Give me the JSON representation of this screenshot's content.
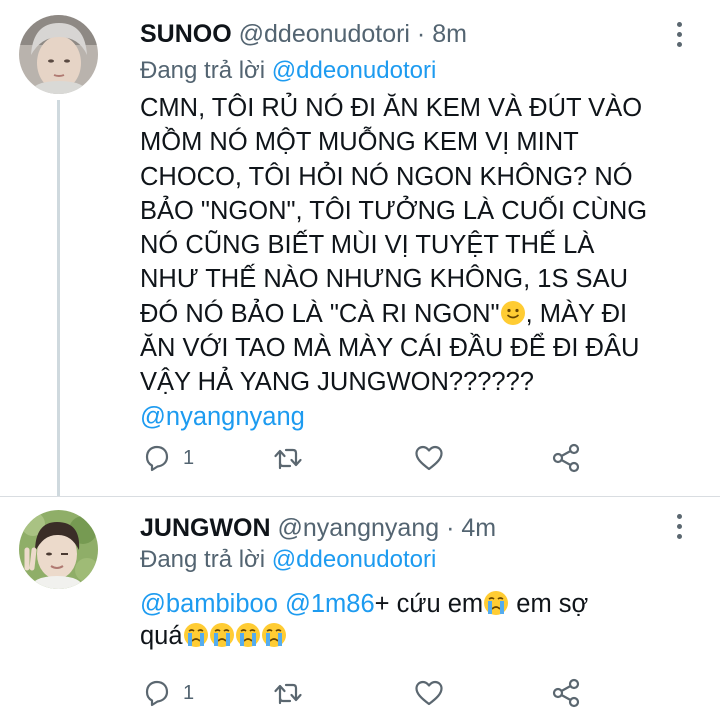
{
  "tweets": [
    {
      "name": "SUNOO",
      "handle": "@ddeonudotori",
      "time": "8m",
      "replying_prefix": "Đang trả lời",
      "replying_to": "@ddeonudotori",
      "body_lines": [
        "CMN, TÔI RỦ NÓ ĐI ĂN KEM VÀ ĐÚT VÀO",
        "MỒM NÓ MỘT MUỖNG KEM VỊ MINT",
        "CHOCO, TÔI HỎI NÓ NGON KHÔNG? NÓ",
        "BẢO \"NGON\", TÔI TƯỞNG LÀ CUỐI CÙNG",
        "NÓ CŨNG BIẾT MÙI VỊ TUYỆT THẾ LÀ",
        "NHƯ THẾ NÀO NHƯNG KHÔNG, 1S SAU",
        "ĐÓ NÓ BẢO LÀ \"CÀ RI NGON\"",
        ", MÀY ĐI",
        "ĂN VỚI TAO MÀ MÀY CÁI ĐẦU ĐỂ ĐI ĐÂU",
        "VẬY HẢ YANG JUNGWON??????",
        "@nyangnyang"
      ],
      "reply_count": "1",
      "icons": [
        "reply-icon",
        "retweet-icon",
        "like-icon",
        "share-icon",
        "smile-emoji"
      ]
    },
    {
      "name": "JUNGWON",
      "handle": "@nyangnyang",
      "time": "4m",
      "replying_prefix": "Đang trả lời",
      "replying_to": "@ddeonudotori",
      "mentions": [
        "@bambiboo",
        "@1m86"
      ],
      "text_a": "+ cứu em",
      "text_b": " em sợ",
      "text_c": "quá",
      "reply_count": "1",
      "icons": [
        "reply-icon",
        "retweet-icon",
        "like-icon",
        "share-icon",
        "crying-emoji"
      ]
    }
  ],
  "separator": " · ",
  "colors": {
    "link": "#1d9bf0",
    "muted": "#536471",
    "text": "#0f1419",
    "icon": "#5b6770"
  }
}
